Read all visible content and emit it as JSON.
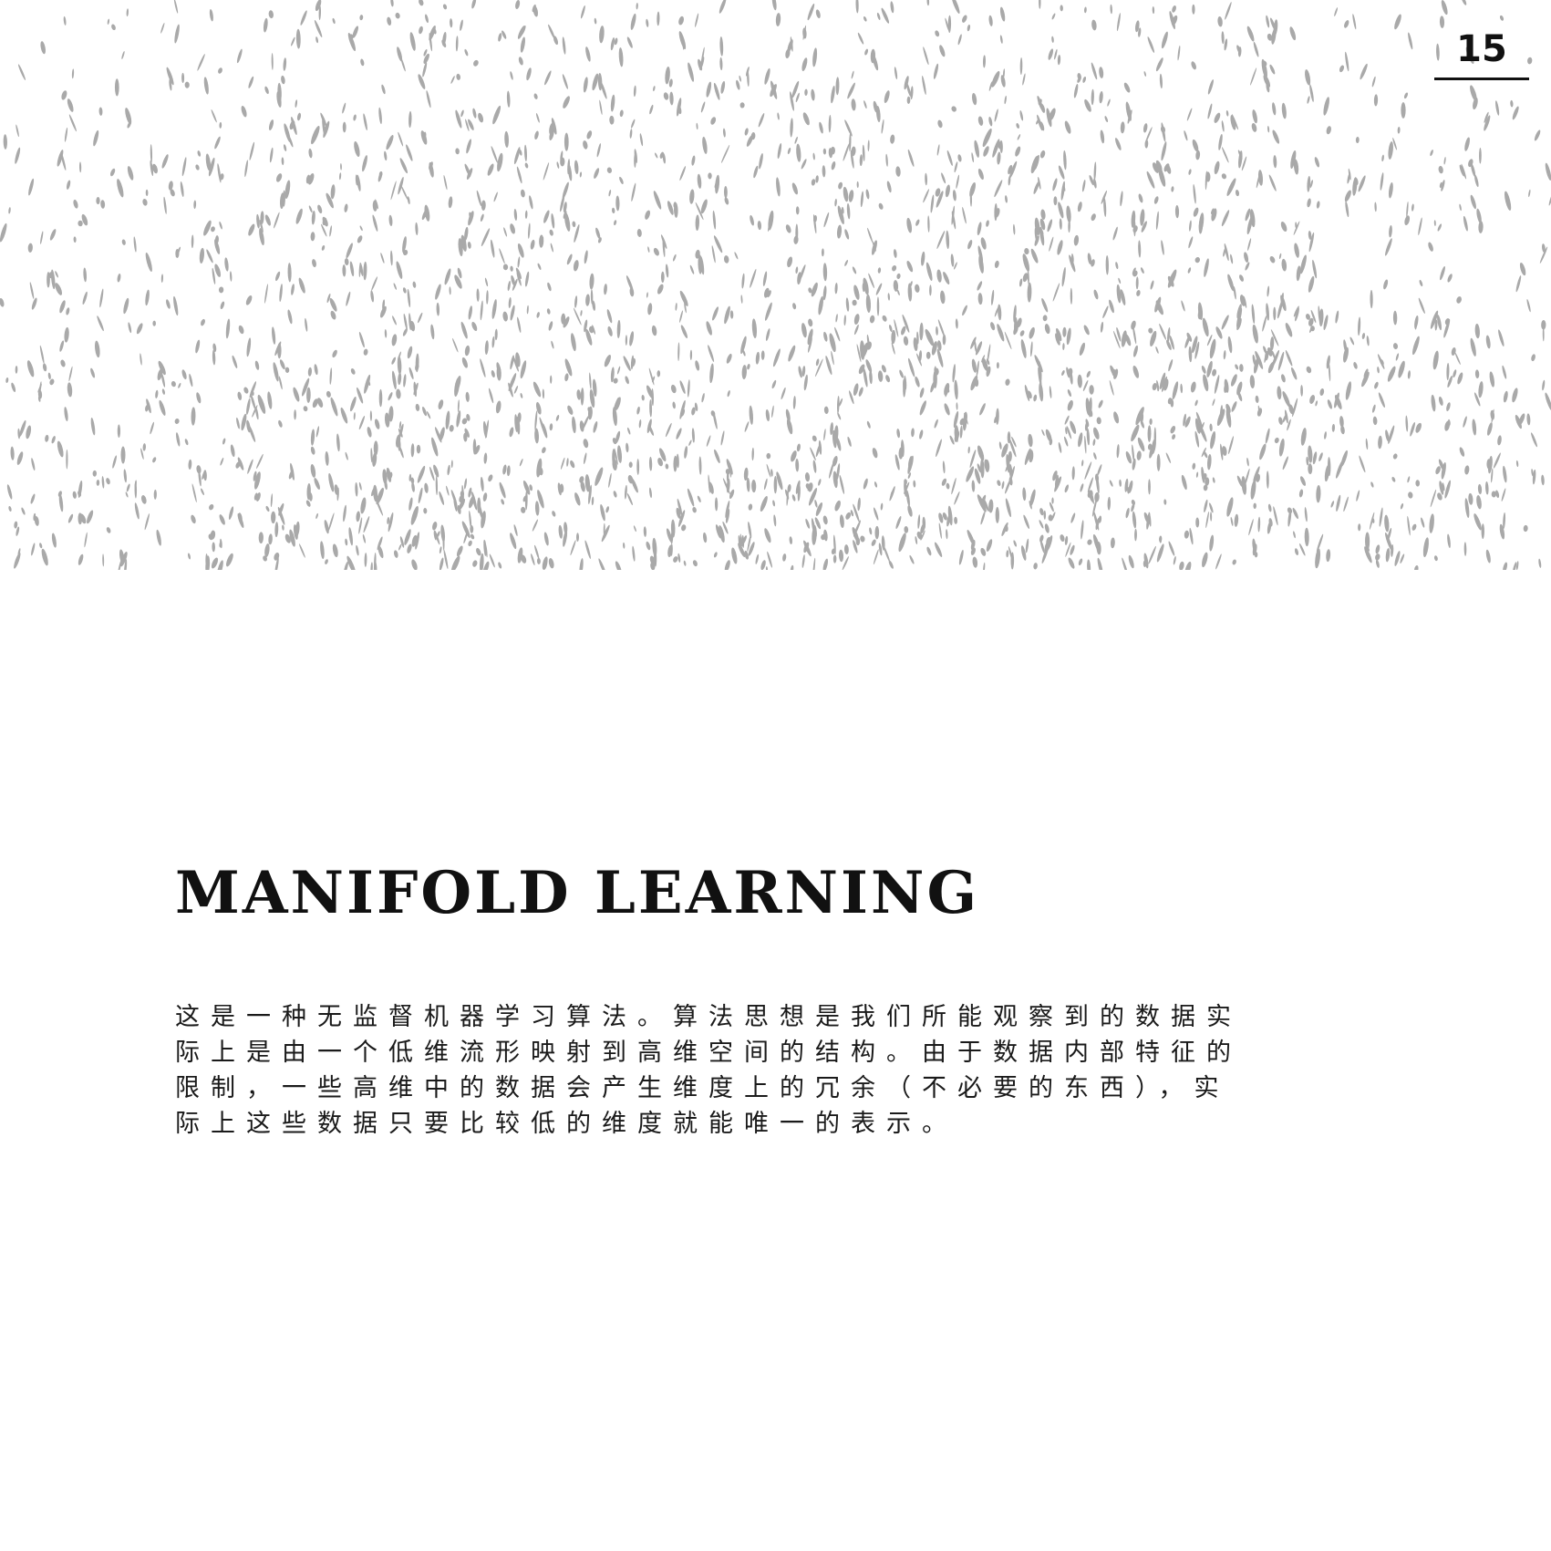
{
  "page": {
    "number": "15"
  },
  "header": {
    "texture_icon": "speckle-texture",
    "texture_color": "#a9a9a9"
  },
  "article": {
    "title": "MANIFOLD LEARNING",
    "body_lines": [
      "这是一种无监督机器学习算法。算法思想是我们所能观察到的数据实",
      "际上是由一个低维流形映射到高维空间的结构。由于数据内部特征的",
      "限制，一些高维中的数据会产生维度上的冗余（不必要的东西），实",
      "际上这些数据只要比较低的维度就能唯一的表示。"
    ]
  }
}
